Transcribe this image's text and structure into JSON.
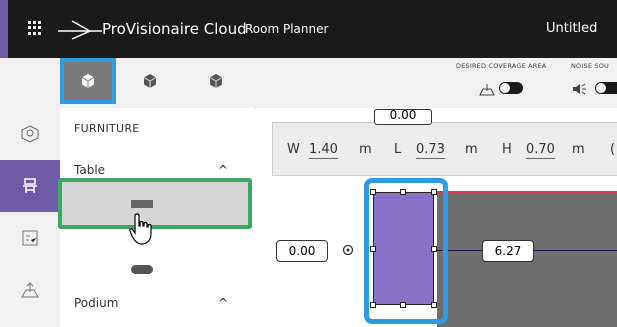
{
  "header": {
    "brand_name": "ProVisionaire Cloud",
    "app_name": "Room Planner",
    "doc_title": "Untitled"
  },
  "toolbar": {
    "view_buttons": [
      {
        "name": "view-3d-top",
        "icon": "cube-icon",
        "active": true
      },
      {
        "name": "view-3d-iso",
        "icon": "cube-icon",
        "active": false
      },
      {
        "name": "view-3d-alt",
        "icon": "cube-icon",
        "active": false
      }
    ],
    "desired_coverage_label": "DESIRED COVERAGE AREA",
    "noise_source_label": "NOISE SOU"
  },
  "left_rail": {
    "items": [
      {
        "icon": "room-shape-icon",
        "active": false
      },
      {
        "icon": "furniture-icon",
        "active": true
      },
      {
        "icon": "checklist-icon",
        "active": false
      },
      {
        "icon": "coverage-area-icon",
        "active": false
      }
    ]
  },
  "panel": {
    "title": "FURNITURE",
    "categories": [
      {
        "label": "Table",
        "caret": "^"
      },
      {
        "label": "Podium",
        "caret": "^"
      }
    ]
  },
  "dimensions": {
    "w_label": "W",
    "w_value": "1.40",
    "w_unit": "m",
    "l_label": "L",
    "l_value": "0.73",
    "l_unit": "m",
    "h_label": "H",
    "h_value": "0.70",
    "h_unit": "m",
    "extra": "("
  },
  "canvas": {
    "top_offset": "0.00",
    "left_offset": "0.00",
    "right_distance": "6.27"
  },
  "colors": {
    "accent_purple": "#6f5aa7",
    "selection_blue": "#2e9be3",
    "selection_green": "#3aa863",
    "table_fill": "#8a72c9"
  }
}
